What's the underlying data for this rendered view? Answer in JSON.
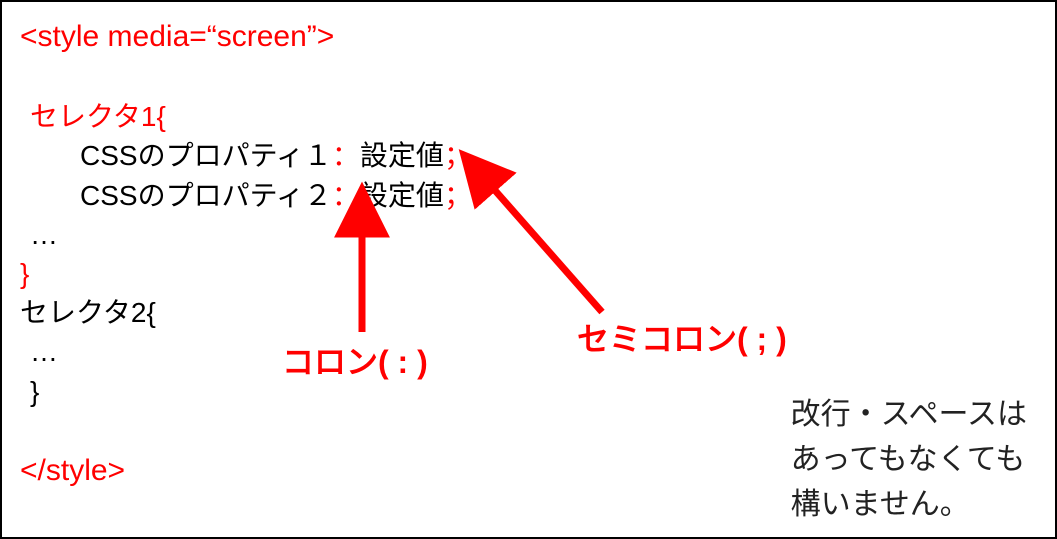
{
  "code": {
    "open_tag": "<style media=“screen”>",
    "selector1_open": "セレクタ1{",
    "prop1_name": "CSSのプロパティ１",
    "prop2_name": "CSSのプロパティ２",
    "value_label": "設定値",
    "colon": "：",
    "semicolon": "；",
    "ellipsis": "…",
    "brace_close": "}",
    "selector2_open": "セレクタ2{",
    "close_tag": "</style>"
  },
  "annotations": {
    "colon_label": "コロン( : )",
    "semicolon_label": "セミコロン( ; )",
    "note_line1": "改行・スペースは",
    "note_line2": "あってもなくても",
    "note_line3": "構いません。"
  }
}
